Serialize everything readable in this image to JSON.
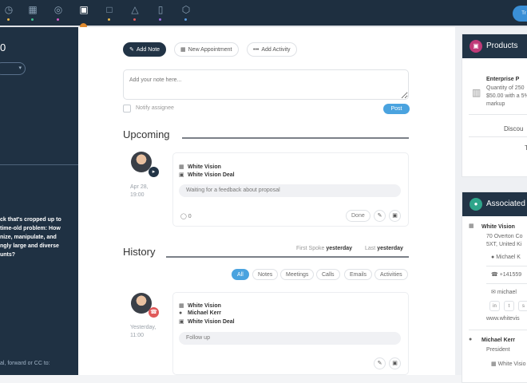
{
  "top_nav": {
    "icons": [
      "clock-icon",
      "grid-icon",
      "target-icon",
      "briefcase-icon",
      "calendar-icon",
      "bell-icon",
      "document-icon",
      "cube-icon"
    ],
    "dot_colors": [
      "#e8b64a",
      "#3fbf8f",
      "#d45ac5",
      "#e8b64a",
      "#e05a5a",
      "#9b6be0",
      "#3fbf8f",
      "#5a9be0"
    ],
    "user_initials": "Tr"
  },
  "left": {
    "number": "0",
    "description": "ck that's cropped up to\ntime-old problem: How\nnize, manipulate, and\nngly large and diverse\nunts?",
    "footer": "al, forward or CC to:"
  },
  "composer": {
    "add_note": "Add Note",
    "new_appointment": "New Appointment",
    "add_activity": "Add Activity",
    "placeholder": "Add your note here...",
    "notify_label": "Notify assignee",
    "post": "Post"
  },
  "upcoming": {
    "title": "Upcoming",
    "item": {
      "date": "Apr 28,",
      "time": "19:00",
      "company": "White Vision",
      "deal": "White Vision Deal",
      "message": "Waiting for a feedback about proposal",
      "comments": "0",
      "done": "Done"
    }
  },
  "history": {
    "title": "History",
    "first_spoke_label": "First Spoke",
    "first_spoke_value": "yesterday",
    "last_label": "Last",
    "last_value": "yesterday",
    "filters": [
      "All",
      "Notes",
      "Meetings",
      "Calls",
      "Emails",
      "Activities"
    ],
    "item": {
      "date": "Yesterday,",
      "time": "11:00",
      "company": "White Vision",
      "contact": "Michael Kerr",
      "deal": "White Vision Deal",
      "message": "Follow up"
    }
  },
  "products": {
    "title": "Products",
    "name": "Enterprise P",
    "qty": "Quantity of 250",
    "price": "$50.00 with a 5%",
    "markup": "markup",
    "discount": "Discou",
    "total": "T"
  },
  "associated": {
    "title": "Associated",
    "company": "White Vision",
    "address1": "70 Overton Co",
    "address2": "5XT, United Ki",
    "contact_short": "Michael K",
    "phone": "+141559",
    "email": "michael",
    "website": "www.whitevis",
    "contact": "Michael Kerr",
    "role": "President",
    "company2": "White Visio"
  },
  "colors": {
    "topbar": "#1e2f40",
    "accent": "#4aa3df",
    "product_icon": "#c03a78",
    "associated_icon": "#2fa58a",
    "call_badge": "#e05a5a"
  }
}
